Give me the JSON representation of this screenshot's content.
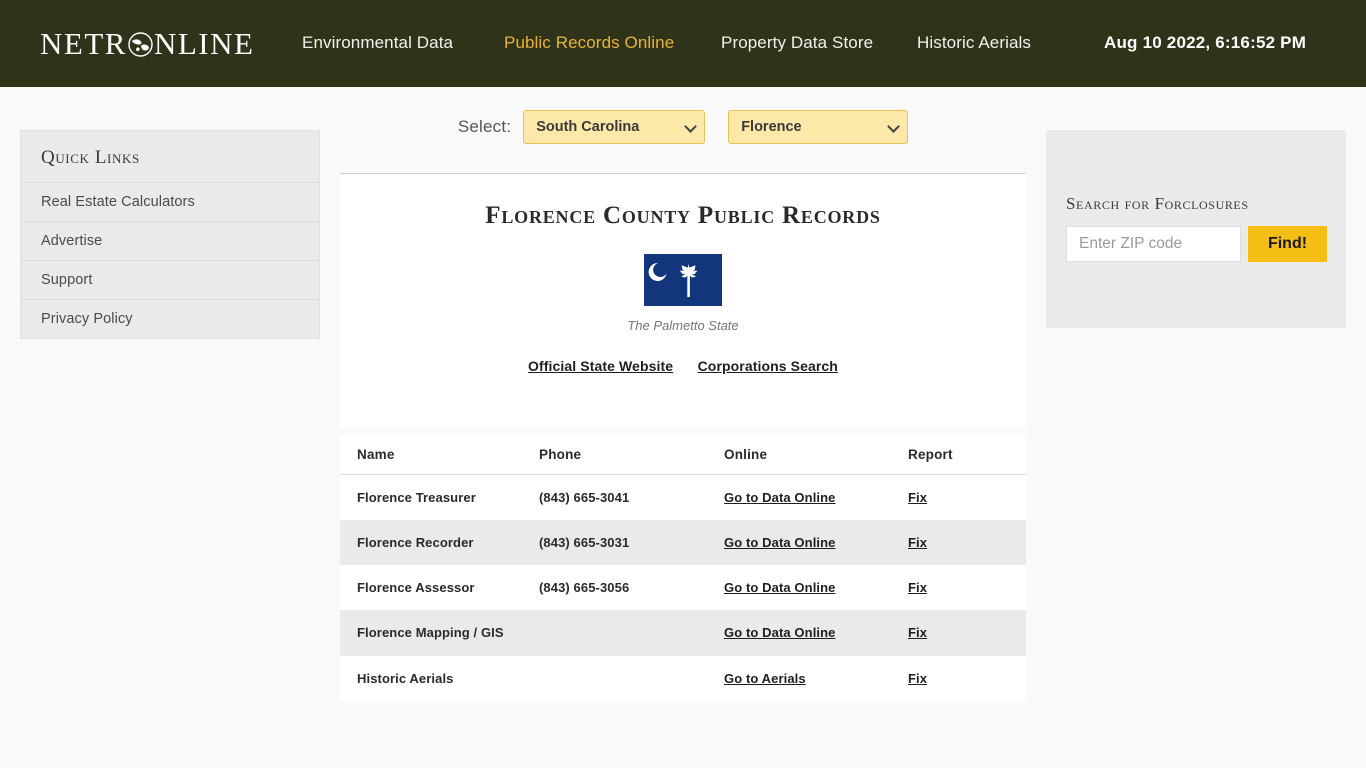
{
  "topbar": {
    "logo_text_parts": {
      "before": "NETR",
      "globe_icon": "globe-icon",
      "after": "NLINE"
    },
    "logo_full": "NETRONLINE",
    "nav": [
      {
        "label": "Environmental Data",
        "active": false
      },
      {
        "label": "Public Records Online",
        "active": true
      },
      {
        "label": "Property Data Store",
        "active": false
      },
      {
        "label": "Historic Aerials",
        "active": false
      }
    ],
    "datetime": "Aug 10 2022, 6:16:52 PM",
    "bg_color": "#2E3319",
    "active_color": "#E8B33A"
  },
  "selectors": {
    "label": "Select:",
    "state": {
      "value": "South Carolina"
    },
    "county": {
      "value": "Florence"
    },
    "bg_color": "#FCE8A8",
    "border_color": "#E7C353"
  },
  "sidebar": {
    "title": "Quick Links",
    "items": [
      {
        "label": "Real Estate Calculators"
      },
      {
        "label": "Advertise"
      },
      {
        "label": "Support"
      },
      {
        "label": "Privacy Policy"
      }
    ]
  },
  "search_panel": {
    "title": "Search for Forclosures",
    "input_value": "",
    "input_placeholder": "Enter ZIP code",
    "button_label": "Find!",
    "button_color": "#F5BE14"
  },
  "main": {
    "title": "Florence County Public Records",
    "flag": {
      "name": "south-carolina-state-flag",
      "color": "#12357C",
      "caption": "The Palmetto State"
    },
    "links": [
      {
        "label": "Official State Website"
      },
      {
        "label": "Corporations Search"
      }
    ]
  },
  "table": {
    "headers": [
      "Name",
      "Phone",
      "Online",
      "Report"
    ],
    "rows": [
      {
        "name": "Florence Treasurer",
        "phone": "(843) 665-3041",
        "online": "Go to Data Online",
        "report": "Fix",
        "alt": false
      },
      {
        "name": "Florence Recorder",
        "phone": "(843) 665-3031",
        "online": "Go to Data Online",
        "report": "Fix",
        "alt": true
      },
      {
        "name": "Florence Assessor",
        "phone": "(843) 665-3056",
        "online": "Go to Data Online",
        "report": "Fix",
        "alt": false
      },
      {
        "name": "Florence Mapping / GIS",
        "phone": "",
        "online": "Go to Data Online",
        "report": "Fix",
        "alt": true
      },
      {
        "name": "Historic Aerials",
        "phone": "",
        "online": "Go to Aerials",
        "report": "Fix",
        "alt": false
      }
    ]
  }
}
